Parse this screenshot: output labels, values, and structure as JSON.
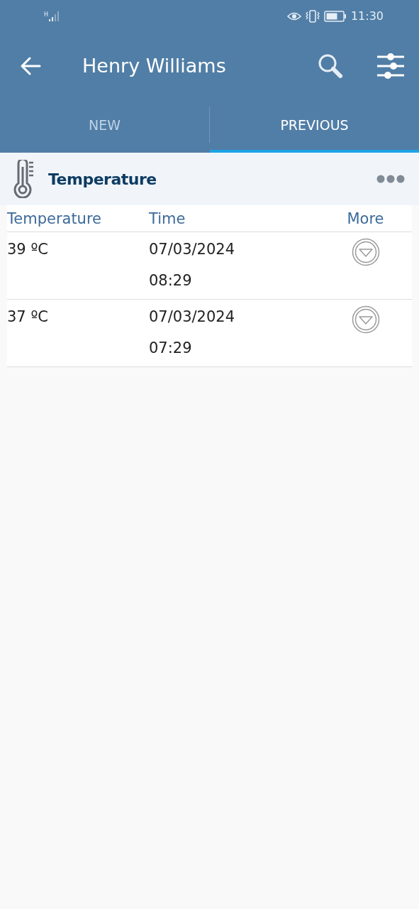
{
  "status_bar": {
    "network": "H",
    "time": "11:30"
  },
  "app_bar": {
    "title": "Henry Williams"
  },
  "tabs": [
    {
      "label": "NEW",
      "selected": false
    },
    {
      "label": "PREVIOUS",
      "selected": true
    }
  ],
  "section": {
    "title": "Temperature"
  },
  "table": {
    "columns": [
      "Temperature",
      "Time",
      "More"
    ],
    "rows": [
      {
        "value": "39 ºC",
        "date": "07/03/2024",
        "time": "08:29"
      },
      {
        "value": "37 ºC",
        "date": "07/03/2024",
        "time": "07:29"
      }
    ]
  }
}
